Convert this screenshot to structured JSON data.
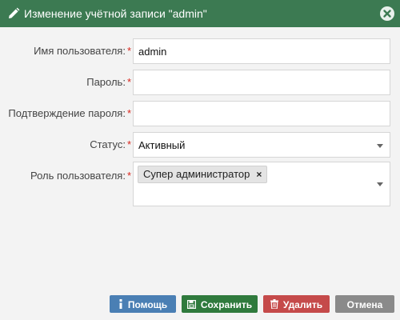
{
  "window": {
    "title": "Изменение учётной записи \"admin\""
  },
  "form": {
    "username": {
      "label": "Имя пользователя:",
      "required_mark": "*",
      "value": "admin"
    },
    "password": {
      "label": "Пароль:",
      "required_mark": "*",
      "value": ""
    },
    "password_confirm": {
      "label": "Подтверждение пароля:",
      "required_mark": "*",
      "value": ""
    },
    "status": {
      "label": "Статус:",
      "required_mark": "*",
      "value": "Активный"
    },
    "role": {
      "label": "Роль пользователя:",
      "required_mark": "*",
      "tags": [
        {
          "text": "Супер администратор",
          "remove": "×"
        }
      ]
    }
  },
  "buttons": {
    "help": "Помощь",
    "save": "Сохранить",
    "delete": "Удалить",
    "cancel": "Отмена"
  },
  "colors": {
    "titlebar": "#3c7a52",
    "required": "#d9261c",
    "help": "#4a7fb4",
    "save": "#2f7a3d",
    "delete": "#c54a4a",
    "cancel": "#8a8a8a"
  },
  "icons": {
    "title": "pencil-icon",
    "close": "close-circle-icon",
    "help": "info-icon",
    "save": "floppy-disk-icon",
    "delete": "trash-icon"
  }
}
